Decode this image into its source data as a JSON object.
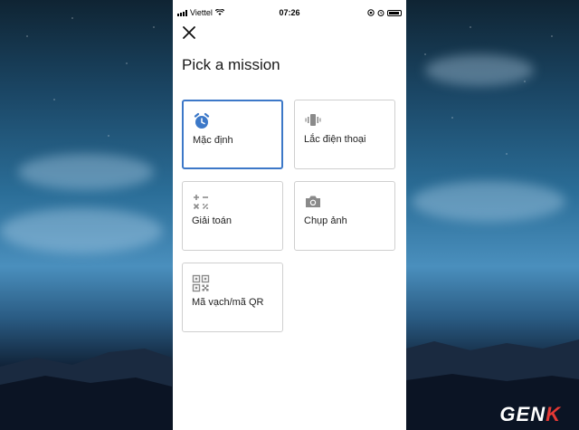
{
  "status_bar": {
    "carrier": "Viettel",
    "time": "07:26"
  },
  "screen": {
    "title": "Pick a mission"
  },
  "missions": [
    {
      "label": "Mặc định",
      "icon": "alarm-clock-icon",
      "selected": true
    },
    {
      "label": "Lắc điện thoại",
      "icon": "phone-shake-icon",
      "selected": false
    },
    {
      "label": "Giải toán",
      "icon": "math-operators-icon",
      "selected": false
    },
    {
      "label": "Chụp ảnh",
      "icon": "camera-icon",
      "selected": false
    },
    {
      "label": "Mã vạch/mã QR",
      "icon": "qr-code-icon",
      "selected": false
    }
  ],
  "watermark": {
    "prefix": "GEN",
    "suffix": "K"
  },
  "colors": {
    "accent": "#3c78c8",
    "card_border": "#cfcfcf",
    "icon_gray": "#8a8a8a"
  }
}
